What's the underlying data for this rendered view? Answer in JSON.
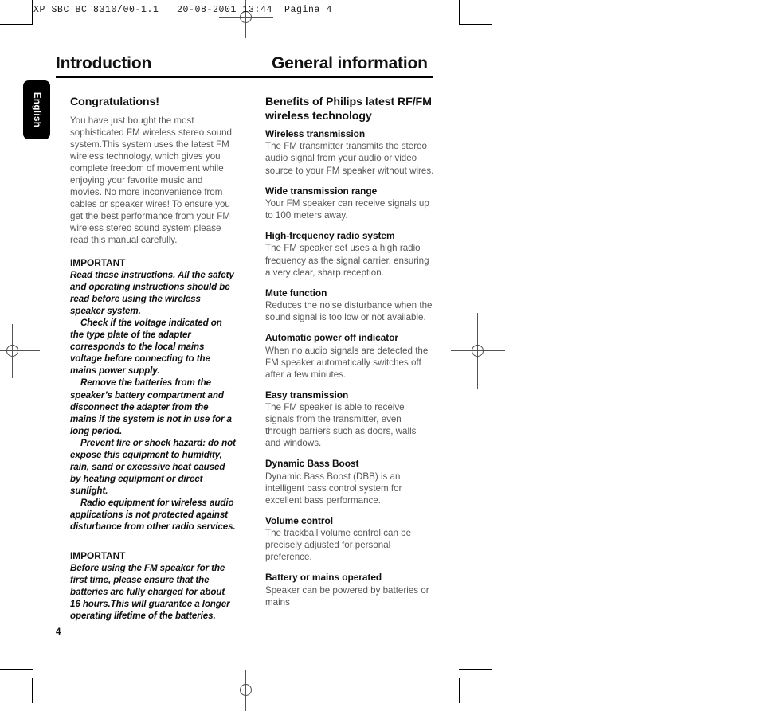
{
  "print_header": "XP SBC BC 8310/00-1.1   20-08-2001 13:44  Pagina 4",
  "language_tab": "English",
  "folio": "4",
  "titles": {
    "left": "Introduction",
    "right": "General information"
  },
  "left_column": {
    "heading": "Congratulations!",
    "intro": "You have just bought the most sophisticated FM wireless stereo sound system.This system uses the latest FM wireless technology, which gives you complete freedom of movement while enjoying your favorite music and movies. No more inconvenience from cables or speaker wires! To ensure you get the best performance from your FM wireless stereo sound system please read this manual carefully.",
    "important_1_label": "IMPORTANT",
    "important_1_paragraphs": [
      "Read these instructions. All the safety and operating instructions should be read before using the wireless speaker system.",
      "Check if the voltage indicated on the type plate of the adapter corresponds to the local mains voltage before connecting to the mains power supply.",
      "Remove the batteries from the speaker’s battery compartment and disconnect the adapter from the mains if the system is not in use for a long period.",
      "Prevent fire or shock hazard: do not expose this equipment to humidity, rain, sand or excessive heat caused by heating equipment or direct sunlight.",
      "Radio equipment for wireless audio applications is not protected against disturbance from other radio services."
    ],
    "important_2_label": "IMPORTANT",
    "important_2_paragraph": "Before using the FM speaker for the first time, please ensure that the batteries are fully charged for about 16 hours.This will guarantee a longer operating lifetime of the batteries."
  },
  "right_column": {
    "heading": "Benefits of Philips latest RF/FM wireless technology",
    "sections": [
      {
        "title": "Wireless transmission",
        "body": "The FM transmitter transmits the stereo audio signal from your audio or video source to your FM speaker without wires."
      },
      {
        "title": "Wide transmission range",
        "body": "Your FM speaker can receive signals up to 100 meters away."
      },
      {
        "title": "High-frequency radio system",
        "body": "The FM speaker set uses a high radio frequency as the signal carrier, ensuring a very clear, sharp reception."
      },
      {
        "title": "Mute function",
        "body": "Reduces the noise disturbance when the sound signal is too low or not available."
      },
      {
        "title": "Automatic power off indicator",
        "body": "When no audio signals are detected the FM speaker automatically switches off after a few minutes."
      },
      {
        "title": "Easy transmission",
        "body": "The FM speaker is able to receive signals from the transmitter, even through barriers such as doors, walls and windows."
      },
      {
        "title": "Dynamic Bass Boost",
        "body": "Dynamic Bass Boost (DBB) is an intelligent bass control system for excellent bass performance."
      },
      {
        "title": "Volume control",
        "body": "The trackball volume control can be precisely adjusted for personal preference."
      },
      {
        "title": "Battery or mains operated",
        "body": "Speaker can be powered by batteries or mains"
      }
    ]
  }
}
